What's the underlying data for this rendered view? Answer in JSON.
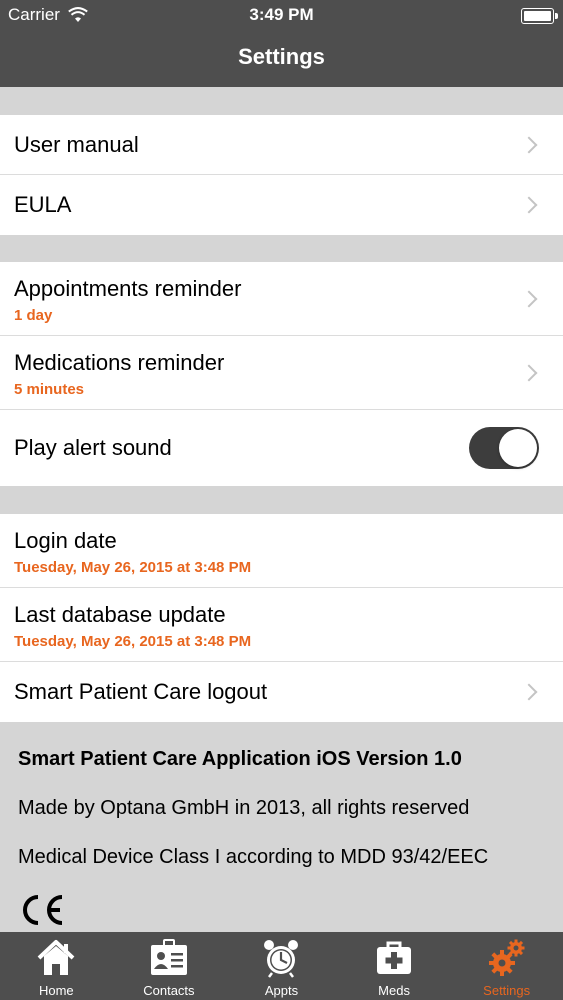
{
  "status": {
    "carrier": "Carrier",
    "time": "3:49 PM"
  },
  "nav": {
    "title": "Settings"
  },
  "groups": {
    "docs": [
      {
        "label": "User manual"
      },
      {
        "label": "EULA"
      }
    ],
    "reminders": [
      {
        "label": "Appointments reminder",
        "value": "1 day"
      },
      {
        "label": "Medications reminder",
        "value": "5 minutes"
      },
      {
        "label": "Play alert sound",
        "toggle_on": true
      }
    ],
    "session": [
      {
        "label": "Login date",
        "value": "Tuesday, May 26, 2015 at 3:48 PM"
      },
      {
        "label": "Last database update",
        "value": "Tuesday, May 26, 2015 at 3:48 PM"
      },
      {
        "label": "Smart Patient Care logout"
      }
    ]
  },
  "footer": {
    "version": "Smart Patient Care Application iOS Version 1.0",
    "made_by": "Made by Optana GmbH in 2013, all rights reserved",
    "device_class": "Medical Device Class I according to MDD 93/42/EEC"
  },
  "tabs": [
    {
      "label": "Home",
      "icon": "house-icon"
    },
    {
      "label": "Contacts",
      "icon": "contact-card-icon"
    },
    {
      "label": "Appts",
      "icon": "alarm-clock-icon"
    },
    {
      "label": "Meds",
      "icon": "medical-kit-icon"
    },
    {
      "label": "Settings",
      "icon": "gears-icon",
      "active": true
    }
  ],
  "colors": {
    "header": "#4e4e4e",
    "accent": "#e8661f",
    "background": "#d5d5d5"
  }
}
